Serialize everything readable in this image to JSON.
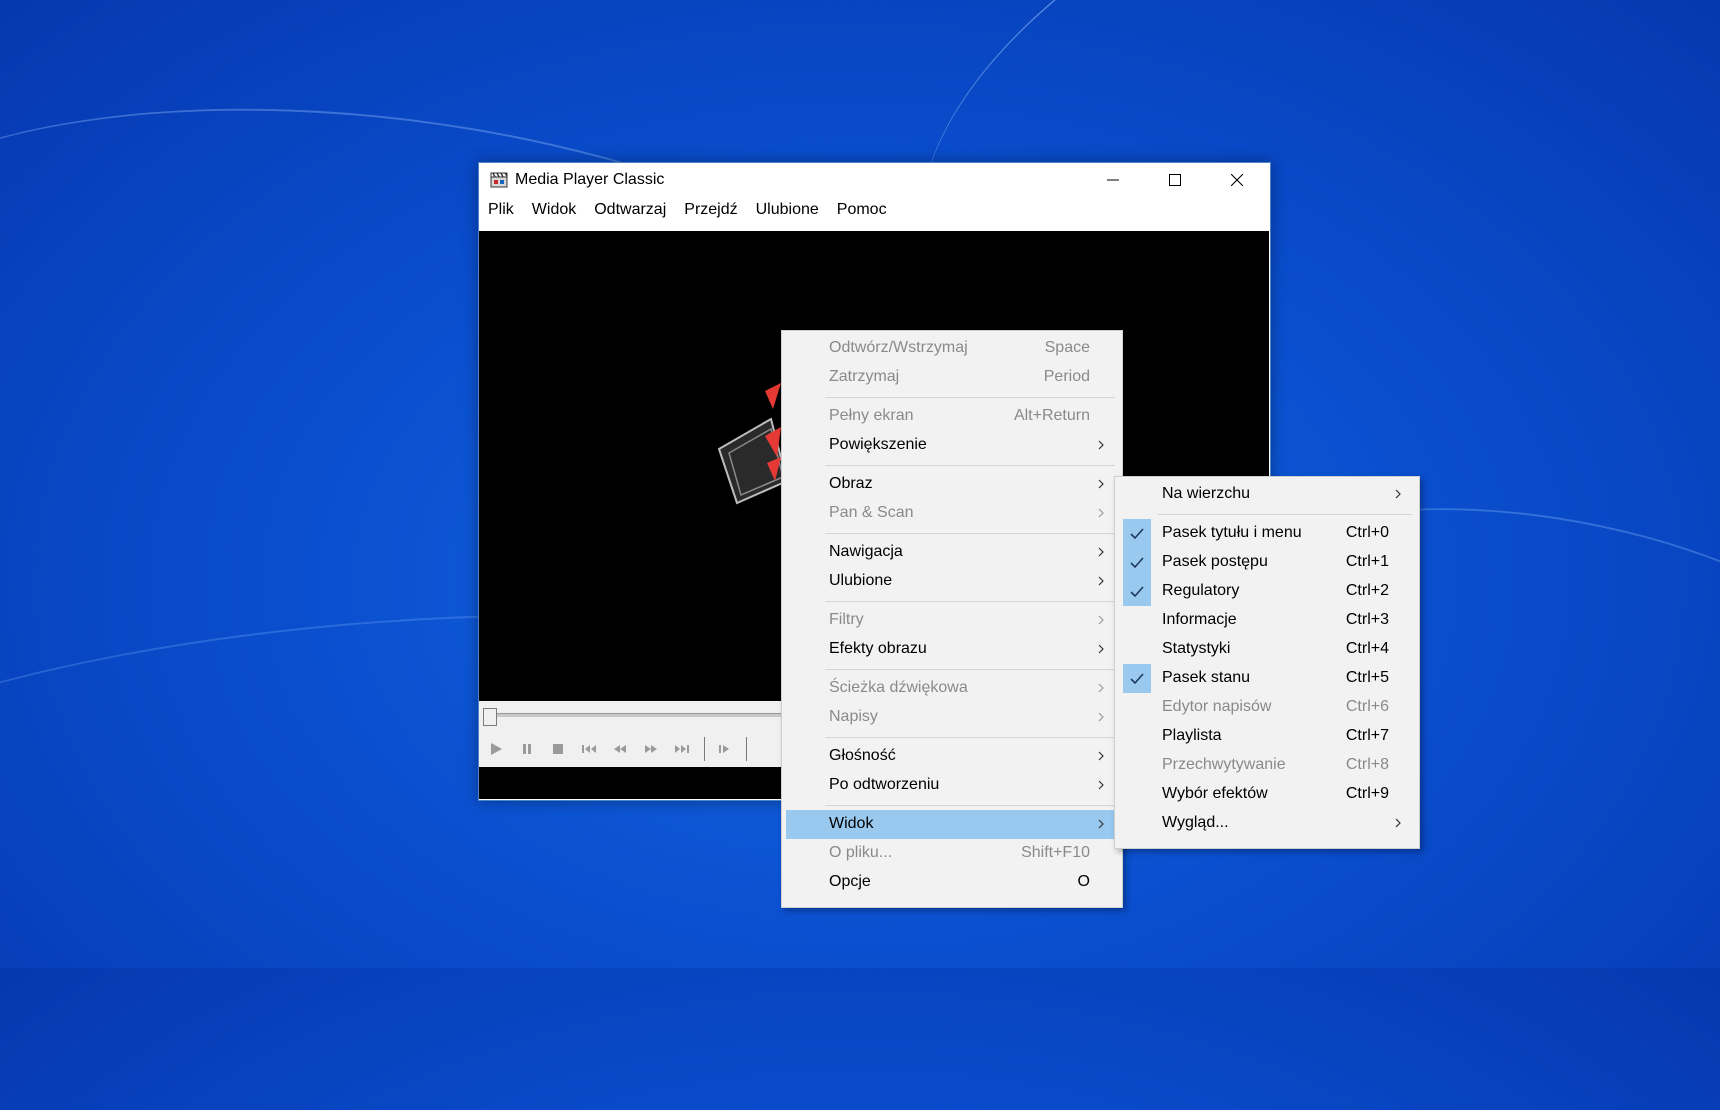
{
  "window": {
    "title": "Media Player Classic",
    "menubar": [
      "Plik",
      "Widok",
      "Odtwarzaj",
      "Przejdź",
      "Ulubione",
      "Pomoc"
    ]
  },
  "context_menu": {
    "items": [
      {
        "label": "Odtwórz/Wstrzymaj",
        "shortcut": "Space",
        "enabled": false
      },
      {
        "label": "Zatrzymaj",
        "shortcut": "Period",
        "enabled": false
      },
      {
        "label": "Pełny ekran",
        "shortcut": "Alt+Return",
        "enabled": false
      },
      {
        "label": "Powiększenie",
        "submenu": true,
        "enabled": true
      },
      {
        "label": "Obraz",
        "submenu": true,
        "enabled": true
      },
      {
        "label": "Pan & Scan",
        "submenu": true,
        "enabled": false
      },
      {
        "label": "Nawigacja",
        "submenu": true,
        "enabled": true
      },
      {
        "label": "Ulubione",
        "submenu": true,
        "enabled": true
      },
      {
        "label": "Filtry",
        "submenu": true,
        "enabled": false
      },
      {
        "label": "Efekty obrazu",
        "submenu": true,
        "enabled": true
      },
      {
        "label": "Ścieżka dźwiękowa",
        "submenu": true,
        "enabled": false
      },
      {
        "label": "Napisy",
        "submenu": true,
        "enabled": false
      },
      {
        "label": "Głośność",
        "submenu": true,
        "enabled": true
      },
      {
        "label": "Po odtworzeniu",
        "submenu": true,
        "enabled": true
      },
      {
        "label": "Widok",
        "submenu": true,
        "enabled": true,
        "highlighted": true
      },
      {
        "label": "O pliku...",
        "shortcut": "Shift+F10",
        "enabled": false
      },
      {
        "label": "Opcje",
        "shortcut": "O",
        "enabled": true
      }
    ]
  },
  "view_submenu": {
    "items": [
      {
        "label": "Na wierzchu",
        "submenu": true,
        "enabled": true
      },
      {
        "label": "Pasek tytułu i menu",
        "shortcut": "Ctrl+0",
        "checked": true,
        "enabled": true
      },
      {
        "label": "Pasek postępu",
        "shortcut": "Ctrl+1",
        "checked": true,
        "enabled": true
      },
      {
        "label": "Regulatory",
        "shortcut": "Ctrl+2",
        "checked": true,
        "enabled": true
      },
      {
        "label": "Informacje",
        "shortcut": "Ctrl+3",
        "checked": false,
        "enabled": true
      },
      {
        "label": "Statystyki",
        "shortcut": "Ctrl+4",
        "checked": false,
        "enabled": true
      },
      {
        "label": "Pasek stanu",
        "shortcut": "Ctrl+5",
        "checked": true,
        "enabled": true
      },
      {
        "label": "Edytor napisów",
        "shortcut": "Ctrl+6",
        "checked": false,
        "enabled": false
      },
      {
        "label": "Playlista",
        "shortcut": "Ctrl+7",
        "checked": false,
        "enabled": true
      },
      {
        "label": "Przechwytywanie",
        "shortcut": "Ctrl+8",
        "checked": false,
        "enabled": false
      },
      {
        "label": "Wybór efektów",
        "shortcut": "Ctrl+9",
        "checked": false,
        "enabled": true
      },
      {
        "label": "Wygląd...",
        "submenu": true,
        "enabled": true
      }
    ]
  },
  "icons": {
    "app": "film-clapper-icon",
    "controls": [
      "play-icon",
      "pause-icon",
      "stop-icon",
      "skip-previous-icon",
      "rewind-icon",
      "fast-forward-icon",
      "skip-next-icon",
      "frame-step-icon"
    ]
  },
  "colors": {
    "highlight": "#99c9ef",
    "disabled_text": "#8a8a8a",
    "menu_background": "#f2f2f2"
  }
}
